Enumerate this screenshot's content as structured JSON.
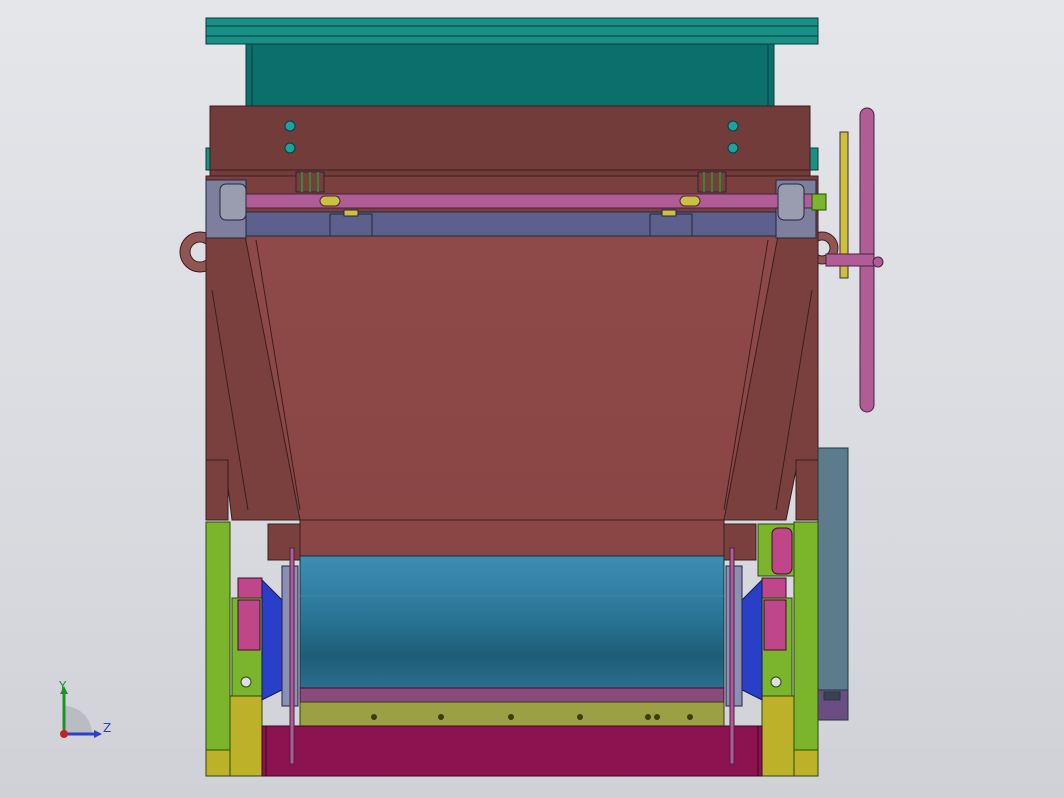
{
  "view": {
    "background": "#dcdee3",
    "projection": "front-orthographic"
  },
  "triad": {
    "axes": [
      "Y",
      "Z"
    ],
    "colors": {
      "y": "#1f8f2a",
      "z": "#2a3fd0",
      "origin": "#c0202a"
    }
  },
  "parts": [
    {
      "name": "top-flange-plate",
      "color": "#1a8f86"
    },
    {
      "name": "feed-chute",
      "color": "#0b6f6c"
    },
    {
      "name": "hopper-top-plate",
      "color": "#723c3a"
    },
    {
      "name": "hopper-body",
      "color": "#8c4847"
    },
    {
      "name": "adjuster-shaft",
      "color": "#b05c97"
    },
    {
      "name": "handwheel",
      "color": "#b05c97"
    },
    {
      "name": "lifting-lug",
      "color": "#905653"
    },
    {
      "name": "drum-roller",
      "color": "#2a7596"
    },
    {
      "name": "side-frame",
      "color": "#7bb52c"
    },
    {
      "name": "base-trough",
      "color": "#8c1350"
    },
    {
      "name": "bottom-rail",
      "color": "#9aa043"
    },
    {
      "name": "motor-housing",
      "color": "#5c7b8b"
    },
    {
      "name": "bearing-block",
      "color": "#2a3fc8"
    },
    {
      "name": "bearing-ring",
      "color": "#c0468a"
    }
  ]
}
